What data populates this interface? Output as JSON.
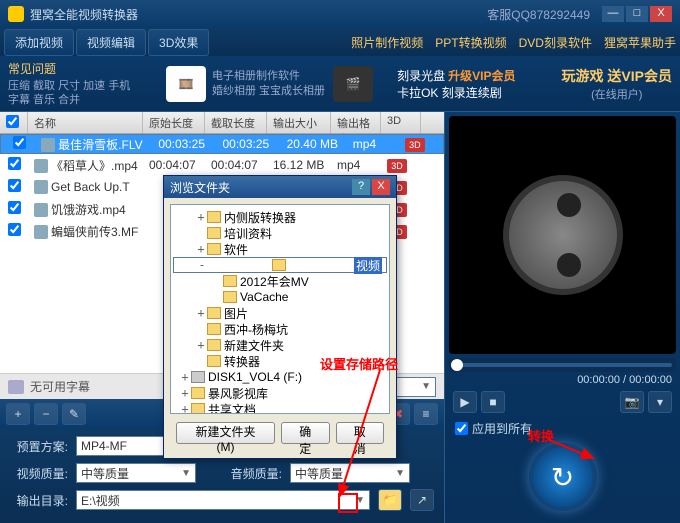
{
  "window": {
    "title": "狸窝全能视频转换器",
    "qq": "客服QQ878292449"
  },
  "winbtns": {
    "min": "—",
    "max": "□",
    "close": "X"
  },
  "nav": {
    "tabs": [
      "添加视频",
      "视频编辑",
      "3D效果"
    ],
    "links": [
      "照片制作视频",
      "PPT转换视频",
      "DVD刻录软件",
      "狸窝苹果助手"
    ]
  },
  "promo": {
    "title": "常见问题",
    "sub": "压缩 截取 尺寸 加速 手机\n字幕 音乐 合并",
    "mid1": "电子相册制作软件\n婚纱相册 宝宝成长相册",
    "mid2a": "刻录光盘",
    "mid2b": "升级VIP会员",
    "mid2c": "卡拉OK 刻录连续剧",
    "right_big": "玩游戏 送VIP会员",
    "right_small": "(在线用户)"
  },
  "list": {
    "headers": {
      "name": "名称",
      "orig": "原始长度",
      "clip": "截取长度",
      "size": "输出大小",
      "fmt": "输出格式",
      "td": "3D"
    },
    "rows": [
      {
        "name": "最佳滑雪板.FLV",
        "orig": "00:03:25",
        "clip": "00:03:25",
        "size": "20.40 MB",
        "fmt": "mp4",
        "sel": true
      },
      {
        "name": "《稻草人》.mp4",
        "orig": "00:04:07",
        "clip": "00:04:07",
        "size": "16.12 MB",
        "fmt": "mp4",
        "sel": false
      },
      {
        "name": "Get Back Up.T",
        "orig": "",
        "clip": "",
        "size": "",
        "fmt": "",
        "sel": false
      },
      {
        "name": "饥饿游戏.mp4",
        "orig": "",
        "clip": "",
        "size": "",
        "fmt": "",
        "sel": false
      },
      {
        "name": "蝙蝠侠前传3.MF",
        "orig": "",
        "clip": "",
        "size": "",
        "fmt": "",
        "sel": false
      }
    ]
  },
  "subtitle": {
    "label": "无可用字幕"
  },
  "bottom": {
    "preset_label": "预置方案:",
    "preset_value": "MP4-MF",
    "vq_label": "视频质量:",
    "vq_value": "中等质量",
    "aq_label": "音频质量:",
    "aq_value": "中等质量",
    "out_label": "输出目录:",
    "out_value": "E:\\视频",
    "apply_label": "应用到所有"
  },
  "preview": {
    "time": "00:00:00 / 00:00:00"
  },
  "dialog": {
    "title": "浏览文件夹",
    "tree": [
      {
        "indent": 1,
        "exp": "+",
        "label": "内侧版转换器"
      },
      {
        "indent": 1,
        "exp": "",
        "label": "培训资料"
      },
      {
        "indent": 1,
        "exp": "+",
        "label": "软件"
      },
      {
        "indent": 1,
        "exp": "-",
        "label": "视频",
        "sel": true
      },
      {
        "indent": 2,
        "exp": "",
        "label": "2012年会MV"
      },
      {
        "indent": 2,
        "exp": "",
        "label": "VaCache"
      },
      {
        "indent": 1,
        "exp": "+",
        "label": "图片"
      },
      {
        "indent": 1,
        "exp": "",
        "label": "西冲-杨梅坑"
      },
      {
        "indent": 1,
        "exp": "+",
        "label": "新建文件夹"
      },
      {
        "indent": 1,
        "exp": "",
        "label": "转换器"
      },
      {
        "indent": 0,
        "exp": "+",
        "label": "DISK1_VOL4 (F:)",
        "drive": true
      },
      {
        "indent": 0,
        "exp": "+",
        "label": "暴风影视库"
      },
      {
        "indent": 0,
        "exp": "+",
        "label": "共享文档"
      }
    ],
    "btn_new": "新建文件夹(M)",
    "btn_ok": "确定",
    "btn_cancel": "取消"
  },
  "annotations": {
    "path": "设置存储路径",
    "convert": "转换"
  }
}
